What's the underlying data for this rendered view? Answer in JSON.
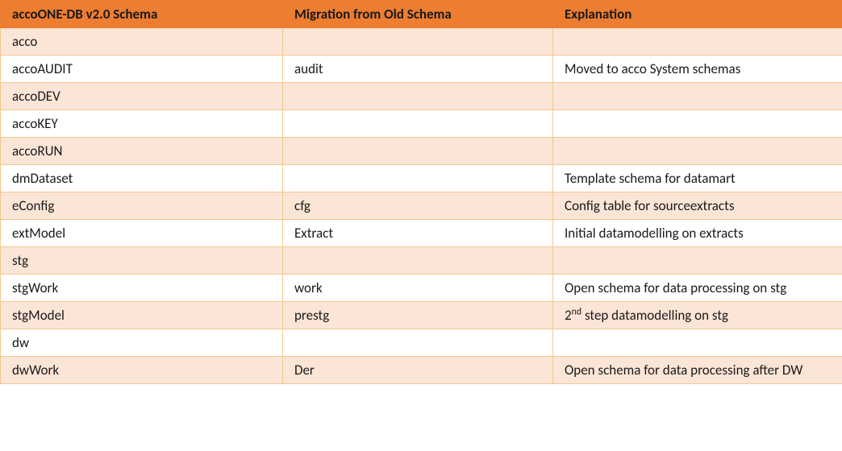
{
  "table": {
    "headers": {
      "col1": "accoONE-DB v2.0 Schema",
      "col2": "Migration from Old Schema",
      "col3": "Explanation"
    },
    "rows": [
      {
        "schema": "acco",
        "migration": "",
        "explanation": ""
      },
      {
        "schema": "accoAUDIT",
        "migration": "audit",
        "explanation": "Moved to acco System schemas"
      },
      {
        "schema": "accoDEV",
        "migration": "",
        "explanation": ""
      },
      {
        "schema": "accoKEY",
        "migration": "",
        "explanation": ""
      },
      {
        "schema": "accoRUN",
        "migration": "",
        "explanation": ""
      },
      {
        "schema": "dmDataset",
        "migration": "",
        "explanation": "Template schema for datamart"
      },
      {
        "schema": "eConfig",
        "migration": "cfg",
        "explanation": "Config table for sourceextracts"
      },
      {
        "schema": "extModel",
        "migration": "Extract",
        "explanation": "Initial datamodelling on extracts"
      },
      {
        "schema": "stg",
        "migration": "",
        "explanation": ""
      },
      {
        "schema": "stgWork",
        "migration": "work",
        "explanation": "Open schema for data processing on stg"
      },
      {
        "schema": "stgModel",
        "migration": "prestg",
        "explanation": "2nd step datamodelling on stg",
        "explanation_html": "2<sup>nd</sup> step datamodelling on stg"
      },
      {
        "schema": "dw",
        "migration": "",
        "explanation": ""
      },
      {
        "schema": "dwWork",
        "migration": "Der",
        "explanation": "Open schema for data processing after DW"
      }
    ]
  }
}
